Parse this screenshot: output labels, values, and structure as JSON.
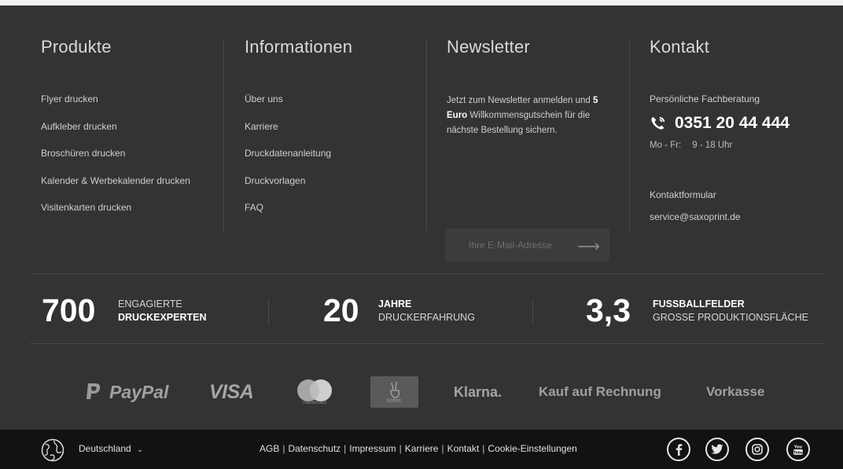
{
  "columns": {
    "produkte": {
      "title": "Produkte",
      "links": [
        "Flyer drucken",
        "Aufkleber drucken",
        "Broschüren drucken",
        "Kalender & Werbekalender drucken",
        "Visitenkarten drucken"
      ]
    },
    "informationen": {
      "title": "Informationen",
      "links": [
        "Über uns",
        "Karriere",
        "Druckdatenanleitung",
        "Druckvorlagen",
        "FAQ"
      ]
    },
    "newsletter": {
      "title": "Newsletter",
      "text_pre": "Jetzt zum Newsletter anmelden und",
      "text_bold": "5 Euro",
      "text_post": "Willkommensgutschein für die nächste Bestellung sichern.",
      "input_placeholder": "Ihre E-Mail-Adresse",
      "submit_icon": "arrow-right-icon"
    },
    "kontakt": {
      "title": "Kontakt",
      "label": "Persönliche Fachberatung",
      "phone": "0351 20 44 444",
      "hours_days": "Mo - Fr:",
      "hours_time": "9 - 18 Uhr",
      "form_link": "Kontaktformular",
      "email": "service@saxoprint.de"
    }
  },
  "stats": [
    {
      "number": "700",
      "line1": "ENGAGIERTE",
      "line2": "DRUCKEXPERTEN"
    },
    {
      "number": "20",
      "line1": "JAHRE",
      "line2": "DRUCKERFAHRUNG"
    },
    {
      "number": "3,3",
      "line1": "FUSSBALLFELDER",
      "line2": "GROSSE PRODUKTIONSFLÄCHE"
    }
  ],
  "payments": {
    "paypal": "PayPal",
    "visa": "VISA",
    "mastercard": "mastercard",
    "sofort": "Sofort.",
    "klarna": "Klarna.",
    "rechnung": "Kauf auf Rechnung",
    "vorkasse": "Vorkasse"
  },
  "bottom": {
    "country": "Deutschland",
    "legal_links": [
      "AGB",
      "Datenschutz",
      "Impressum",
      "Karriere",
      "Kontakt",
      "Cookie-Einstellungen"
    ],
    "social": [
      "facebook-icon",
      "twitter-icon",
      "instagram-icon",
      "youtube-icon"
    ],
    "youtube_text": "You Tube"
  },
  "colors": {
    "background": "#333333",
    "bottom_bar": "#121212",
    "text": "#d6d6d6",
    "heading": "#d9d9d9",
    "white": "#ffffff"
  }
}
